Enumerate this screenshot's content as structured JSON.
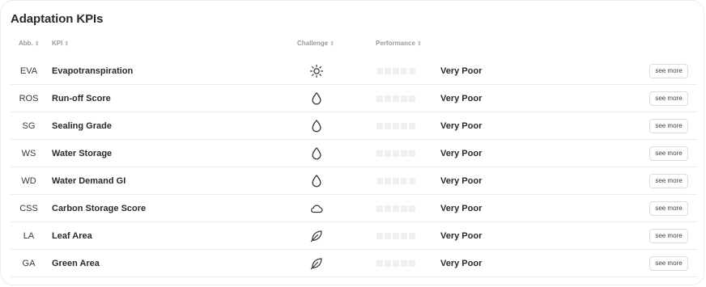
{
  "title": "Adaptation KPIs",
  "columns": {
    "abb": "Abb.",
    "kpi": "KPI",
    "challenge": "Challenge",
    "performance": "Performance",
    "sort_glyph": "⇕"
  },
  "see_more_label": "see more",
  "rows": [
    {
      "abb": "EVA",
      "kpi": "Evapotranspiration",
      "challenge_icon": "sun-icon",
      "performance_level": 0,
      "performance": "Very Poor"
    },
    {
      "abb": "ROS",
      "kpi": "Run-off Score",
      "challenge_icon": "water-drop-icon",
      "performance_level": 0,
      "performance": "Very Poor"
    },
    {
      "abb": "SG",
      "kpi": "Sealing Grade",
      "challenge_icon": "water-drop-icon",
      "performance_level": 0,
      "performance": "Very Poor"
    },
    {
      "abb": "WS",
      "kpi": "Water Storage",
      "challenge_icon": "water-drop-icon",
      "performance_level": 0,
      "performance": "Very Poor"
    },
    {
      "abb": "WD",
      "kpi": "Water Demand GI",
      "challenge_icon": "water-drop-icon",
      "performance_level": 0,
      "performance": "Very Poor"
    },
    {
      "abb": "CSS",
      "kpi": "Carbon Storage Score",
      "challenge_icon": "cloud-icon",
      "performance_level": 0,
      "performance": "Very Poor"
    },
    {
      "abb": "LA",
      "kpi": "Leaf Area",
      "challenge_icon": "leaf-icon",
      "performance_level": 0,
      "performance": "Very Poor"
    },
    {
      "abb": "GA",
      "kpi": "Green Area",
      "challenge_icon": "leaf-icon",
      "performance_level": 0,
      "performance": "Very Poor"
    }
  ]
}
